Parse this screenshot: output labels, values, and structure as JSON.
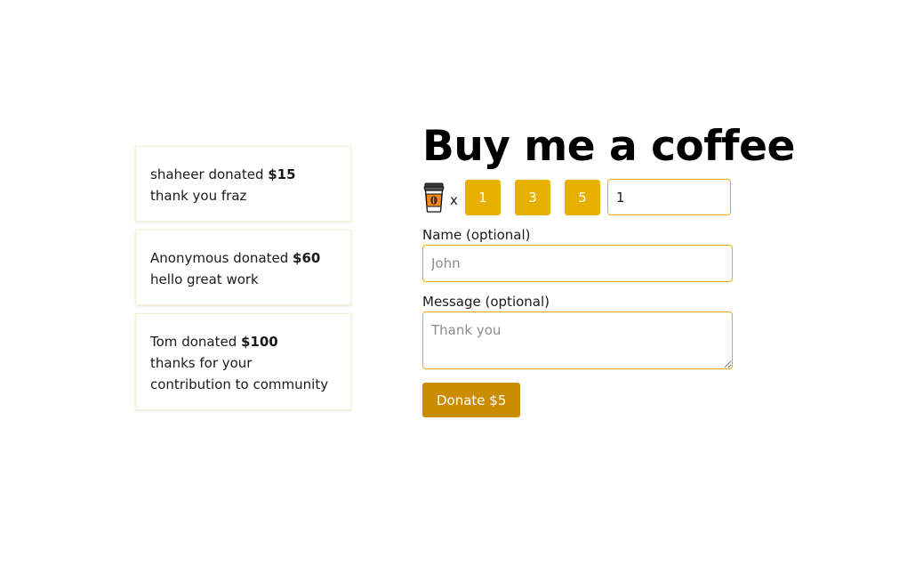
{
  "donations": [
    {
      "name": "shaheer",
      "verb": "donated",
      "amount": "$15",
      "message": "thank you fraz"
    },
    {
      "name": "Anonymous",
      "verb": "donated",
      "amount": "$60",
      "message": "hello great work"
    },
    {
      "name": "Tom",
      "verb": "donated",
      "amount": "$100",
      "message": "thanks for your contribution to community"
    }
  ],
  "panel": {
    "title": "Buy me a coffee",
    "times_symbol": "x",
    "quantity_options": [
      "1",
      "3",
      "5"
    ],
    "quantity_value": "1",
    "name_label": "Name (optional)",
    "name_placeholder": "John",
    "message_label": "Message (optional)",
    "message_placeholder": "Thank you",
    "donate_label": "Donate $5"
  },
  "icons": {
    "coffee": "coffee-cup-icon"
  },
  "colors": {
    "accent": "#e8b000",
    "donate_button": "#cc8c00",
    "input_border": "#e0b000",
    "card_border": "#f6f0cc"
  }
}
